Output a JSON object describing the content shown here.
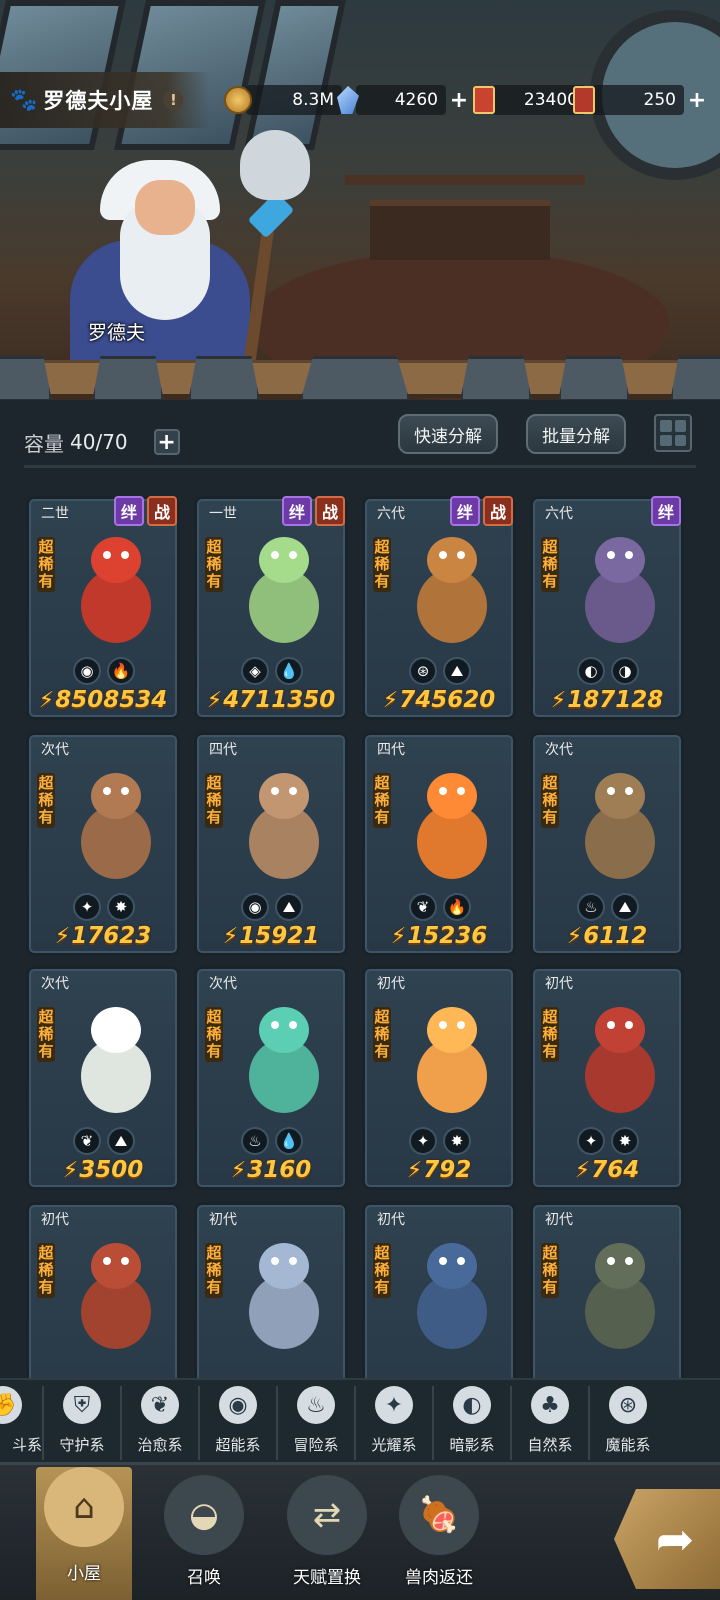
{
  "scene": {
    "npc_name": "罗德夫"
  },
  "topbar": {
    "title": "罗德夫小屋",
    "info": "!",
    "resources": [
      {
        "icon": "gold-coin-icon",
        "value": "8.3M",
        "has_plus": false
      },
      {
        "icon": "crystal-icon",
        "value": "4260",
        "has_plus": true
      },
      {
        "icon": "ticket-icon",
        "value": "23400",
        "has_plus": false
      },
      {
        "icon": "scroll-ticket-icon",
        "value": "250",
        "has_plus": true
      }
    ]
  },
  "panel": {
    "capacity_label": "容量",
    "capacity_value": "40/70",
    "quick_decompose": "快速分解",
    "batch_decompose": "批量分解"
  },
  "tags": {
    "bond": "绊",
    "war": "战"
  },
  "rarity_label": "超稀有",
  "cards": [
    {
      "gen": "二世",
      "tags": [
        "bond",
        "war"
      ],
      "elems": [
        "◉",
        "🔥"
      ],
      "power": "8508534",
      "color": "#c0392b"
    },
    {
      "gen": "一世",
      "tags": [
        "bond",
        "war"
      ],
      "elems": [
        "◈",
        "💧"
      ],
      "power": "4711350",
      "color": "#8fbf7a"
    },
    {
      "gen": "六代",
      "tags": [
        "bond",
        "war"
      ],
      "elems": [
        "⊛",
        "⛰"
      ],
      "power": "745620",
      "color": "#b0743a"
    },
    {
      "gen": "六代",
      "tags": [
        "bond"
      ],
      "elems": [
        "◐",
        "◑"
      ],
      "power": "187128",
      "color": "#6a5a8c"
    },
    {
      "gen": "次代",
      "tags": [],
      "elems": [
        "✦",
        "✸"
      ],
      "power": "17623",
      "color": "#9b6a48"
    },
    {
      "gen": "四代",
      "tags": [],
      "elems": [
        "◉",
        "⛰"
      ],
      "power": "15921",
      "color": "#a98262"
    },
    {
      "gen": "四代",
      "tags": [],
      "elems": [
        "❦",
        "🔥"
      ],
      "power": "15236",
      "color": "#e0782e"
    },
    {
      "gen": "次代",
      "tags": [],
      "elems": [
        "♨",
        "⛰"
      ],
      "power": "6112",
      "color": "#8a6d4a"
    },
    {
      "gen": "次代",
      "tags": [],
      "elems": [
        "❦",
        "⛰"
      ],
      "power": "3500",
      "color": "#dfe6e0"
    },
    {
      "gen": "次代",
      "tags": [],
      "elems": [
        "♨",
        "💧"
      ],
      "power": "3160",
      "color": "#4fb39c"
    },
    {
      "gen": "初代",
      "tags": [],
      "elems": [
        "✦",
        "✸"
      ],
      "power": "792",
      "color": "#f0a04a"
    },
    {
      "gen": "初代",
      "tags": [],
      "elems": [
        "✦",
        "✸"
      ],
      "power": "764",
      "color": "#a8392e"
    },
    {
      "gen": "初代",
      "tags": [],
      "elems": [],
      "power": "",
      "color": "#a1432f"
    },
    {
      "gen": "初代",
      "tags": [],
      "elems": [],
      "power": "",
      "color": "#8fa0b8"
    },
    {
      "gen": "初代",
      "tags": [],
      "elems": [],
      "power": "",
      "color": "#3f5c86"
    },
    {
      "gen": "初代",
      "tags": [],
      "elems": [],
      "power": "",
      "color": "#56604e"
    }
  ],
  "element_filters": [
    {
      "label": "斗系",
      "icon": "fist-icon",
      "glyph": "✊"
    },
    {
      "label": "守护系",
      "icon": "shield-icon",
      "glyph": "⛨"
    },
    {
      "label": "治愈系",
      "icon": "sprout-icon",
      "glyph": "❦"
    },
    {
      "label": "超能系",
      "icon": "alien-icon",
      "glyph": "◉"
    },
    {
      "label": "冒险系",
      "icon": "flame-badge-icon",
      "glyph": "♨"
    },
    {
      "label": "光耀系",
      "icon": "star-burst-icon",
      "glyph": "✦"
    },
    {
      "label": "暗影系",
      "icon": "eye-icon",
      "glyph": "◐"
    },
    {
      "label": "自然系",
      "icon": "leaf-icon",
      "glyph": "♣"
    },
    {
      "label": "魔能系",
      "icon": "magic-ring-icon",
      "glyph": "⊛"
    }
  ],
  "bottom_nav": [
    {
      "label": "小屋",
      "icon": "house-icon",
      "glyph": "⌂",
      "active": true
    },
    {
      "label": "召唤",
      "icon": "egg-icon",
      "glyph": "◒",
      "active": false
    },
    {
      "label": "天赋置换",
      "icon": "swap-icon",
      "glyph": "⇄",
      "active": false
    },
    {
      "label": "兽肉返还",
      "icon": "meat-icon",
      "glyph": "🍖",
      "active": false
    }
  ],
  "go_icon": "curved-arrow-icon"
}
